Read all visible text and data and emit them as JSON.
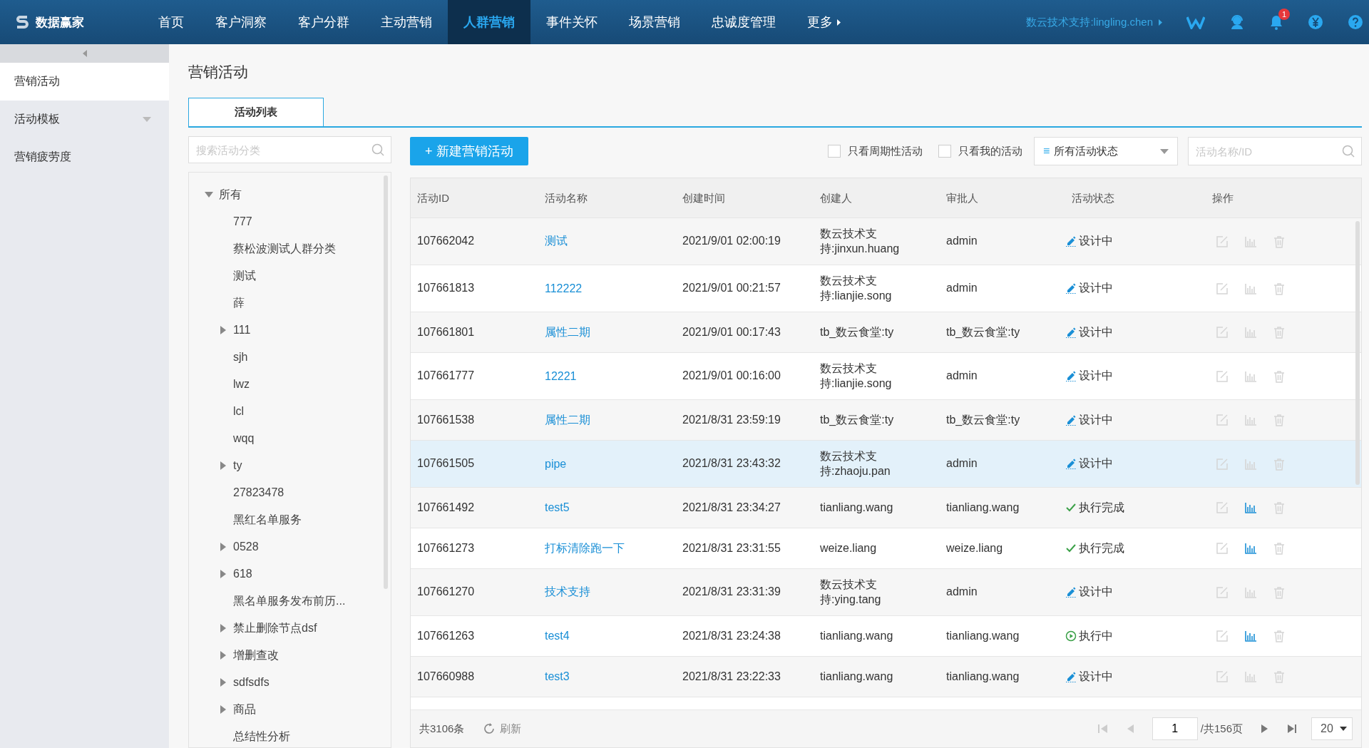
{
  "brand": "数据赢家",
  "nav": [
    {
      "label": "首页",
      "selected": false
    },
    {
      "label": "客户洞察",
      "selected": false
    },
    {
      "label": "客户分群",
      "selected": false
    },
    {
      "label": "主动营销",
      "selected": false
    },
    {
      "label": "人群营销",
      "selected": true
    },
    {
      "label": "事件关怀",
      "selected": false
    },
    {
      "label": "场景营销",
      "selected": false
    },
    {
      "label": "忠诚度管理",
      "selected": false
    },
    {
      "label": "更多",
      "selected": false
    }
  ],
  "user": "数云技术支持:lingling.chen",
  "notification_count": "1",
  "sidebar": {
    "items": [
      {
        "label": "营销活动",
        "selected": true,
        "expandable": false
      },
      {
        "label": "活动模板",
        "selected": false,
        "expandable": true
      },
      {
        "label": "营销疲劳度",
        "selected": false,
        "expandable": false
      }
    ]
  },
  "page_title": "营销活动",
  "tabs": [
    {
      "label": "活动列表",
      "selected": true
    }
  ],
  "category_search": {
    "placeholder": "搜索活动分类"
  },
  "tree": [
    {
      "label": "所有",
      "kind": "folder",
      "expanded": true,
      "children": [
        {
          "label": "777",
          "kind": "leaf"
        },
        {
          "label": "蔡松波测试人群分类",
          "kind": "leaf"
        },
        {
          "label": "测试",
          "kind": "leaf"
        },
        {
          "label": "薛",
          "kind": "leaf"
        },
        {
          "label": "111",
          "kind": "folder",
          "expanded": false
        },
        {
          "label": "sjh",
          "kind": "leaf"
        },
        {
          "label": "lwz",
          "kind": "leaf"
        },
        {
          "label": "lcl",
          "kind": "leaf"
        },
        {
          "label": "wqq",
          "kind": "leaf"
        },
        {
          "label": "ty",
          "kind": "folder",
          "expanded": false
        },
        {
          "label": "27823478",
          "kind": "leaf"
        },
        {
          "label": "黑红名单服务",
          "kind": "leaf"
        },
        {
          "label": "0528",
          "kind": "folder",
          "expanded": false
        },
        {
          "label": "618",
          "kind": "folder",
          "expanded": false
        },
        {
          "label": "黑名单服务发布前历...",
          "kind": "leaf"
        },
        {
          "label": "禁止删除节点dsf",
          "kind": "folder",
          "expanded": false
        },
        {
          "label": "增删查改",
          "kind": "folder",
          "expanded": false
        },
        {
          "label": "sdfsdfs",
          "kind": "folder",
          "expanded": false
        },
        {
          "label": "商品",
          "kind": "folder",
          "expanded": false
        },
        {
          "label": "总结性分析",
          "kind": "leaf"
        }
      ]
    }
  ],
  "new_button": "+ 新建营销活动",
  "filters": [
    {
      "label": "只看周期性活动",
      "checked": false
    },
    {
      "label": "只看我的活动",
      "checked": false
    }
  ],
  "status_select": {
    "icon": "≡",
    "value": "所有活动状态"
  },
  "activity_search": {
    "placeholder": "活动名称/ID"
  },
  "table": {
    "columns": [
      "活动ID",
      "活动名称",
      "创建时间",
      "创建人",
      "审批人",
      "活动状态",
      "操作"
    ],
    "rows": [
      {
        "id": "107662042",
        "name": "测试",
        "created": "2021/9/01 02:00:19",
        "creator": "数云技术支持:jinxun.huang",
        "approver": "admin",
        "status": "设计中",
        "kind": "design",
        "stats_enabled": false,
        "selected": false
      },
      {
        "id": "107661813",
        "name": "112222",
        "created": "2021/9/01 00:21:57",
        "creator": "数云技术支持:lianjie.song",
        "approver": "admin",
        "status": "设计中",
        "kind": "design",
        "stats_enabled": false,
        "selected": false
      },
      {
        "id": "107661801",
        "name": "属性二期",
        "created": "2021/9/01 00:17:43",
        "creator": "tb_数云食堂:ty",
        "approver": "tb_数云食堂:ty",
        "status": "设计中",
        "kind": "design",
        "stats_enabled": false,
        "selected": false
      },
      {
        "id": "107661777",
        "name": "12221",
        "created": "2021/9/01 00:16:00",
        "creator": "数云技术支持:lianjie.song",
        "approver": "admin",
        "status": "设计中",
        "kind": "design",
        "stats_enabled": false,
        "selected": false
      },
      {
        "id": "107661538",
        "name": "属性二期",
        "created": "2021/8/31 23:59:19",
        "creator": "tb_数云食堂:ty",
        "approver": "tb_数云食堂:ty",
        "status": "设计中",
        "kind": "design",
        "stats_enabled": false,
        "selected": false
      },
      {
        "id": "107661505",
        "name": "pipe",
        "created": "2021/8/31 23:43:32",
        "creator": "数云技术支持:zhaoju.pan",
        "approver": "admin",
        "status": "设计中",
        "kind": "design",
        "stats_enabled": false,
        "selected": true
      },
      {
        "id": "107661492",
        "name": "test5",
        "created": "2021/8/31 23:34:27",
        "creator": "tianliang.wang",
        "approver": "tianliang.wang",
        "status": "执行完成",
        "kind": "done",
        "stats_enabled": true,
        "selected": false
      },
      {
        "id": "107661273",
        "name": "打标清除跑一下",
        "created": "2021/8/31 23:31:55",
        "creator": "weize.liang",
        "approver": "weize.liang",
        "status": "执行完成",
        "kind": "done",
        "stats_enabled": true,
        "selected": false
      },
      {
        "id": "107661270",
        "name": "技术支持",
        "created": "2021/8/31 23:31:39",
        "creator": "数云技术支持:ying.tang",
        "approver": "admin",
        "status": "设计中",
        "kind": "design",
        "stats_enabled": false,
        "selected": false
      },
      {
        "id": "107661263",
        "name": "test4",
        "created": "2021/8/31 23:24:38",
        "creator": "tianliang.wang",
        "approver": "tianliang.wang",
        "status": "执行中",
        "kind": "running",
        "stats_enabled": true,
        "selected": false
      },
      {
        "id": "107660988",
        "name": "test3",
        "created": "2021/8/31 23:22:33",
        "creator": "tianliang.wang",
        "approver": "tianliang.wang",
        "status": "设计中",
        "kind": "design",
        "stats_enabled": false,
        "selected": false
      }
    ]
  },
  "footer": {
    "total": "共3106条",
    "refresh": "刷新",
    "page": "1",
    "pages": "/共156页",
    "page_size": "20"
  }
}
